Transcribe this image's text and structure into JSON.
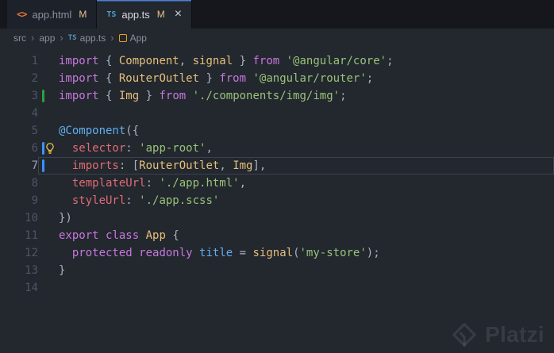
{
  "theme": {
    "kw": "#c678dd",
    "cls": "#e5c07b",
    "fn": "#61afef",
    "prop": "#e06c75",
    "str": "#98c379",
    "pun": "#abb2bf",
    "var": "#61afef",
    "added": "#2ea043",
    "modified": "#3794ff",
    "bulb": "#ffcb43",
    "accent": "#4c7fd6",
    "modified_badge": "#e2c08d",
    "editor_background": "#23272e"
  },
  "tabs": [
    {
      "label": "app.html",
      "icon": "html-file-icon",
      "icon_text": "<>",
      "modified_badge": "M",
      "active": false
    },
    {
      "label": "app.ts",
      "icon": "ts-file-icon",
      "icon_text": "TS",
      "modified_badge": "M",
      "close_label": "×",
      "active": true
    }
  ],
  "breadcrumb": {
    "separator": "›",
    "items": [
      {
        "label": "src"
      },
      {
        "label": "app"
      },
      {
        "label": "app.ts",
        "icon": "ts-file-icon"
      },
      {
        "label": "App",
        "icon": "class-symbol-icon"
      }
    ]
  },
  "editor": {
    "active_line": 7,
    "lightbulb_line": 6,
    "gutter": {
      "added_lines": [
        3
      ],
      "modified_lines": [
        6,
        7
      ]
    },
    "lines": [
      {
        "n": 1,
        "t": [
          [
            "kw",
            "import"
          ],
          [
            "pun",
            " { "
          ],
          [
            "cls",
            "Component"
          ],
          [
            "pun",
            ", "
          ],
          [
            "cls",
            "signal"
          ],
          [
            "pun",
            " } "
          ],
          [
            "kw",
            "from"
          ],
          [
            "pun",
            " "
          ],
          [
            "str",
            "'@angular/core'"
          ],
          [
            "pun",
            ";"
          ]
        ]
      },
      {
        "n": 2,
        "t": [
          [
            "kw",
            "import"
          ],
          [
            "pun",
            " { "
          ],
          [
            "cls",
            "RouterOutlet"
          ],
          [
            "pun",
            " } "
          ],
          [
            "kw",
            "from"
          ],
          [
            "pun",
            " "
          ],
          [
            "str",
            "'@angular/router'"
          ],
          [
            "pun",
            ";"
          ]
        ]
      },
      {
        "n": 3,
        "t": [
          [
            "kw",
            "import"
          ],
          [
            "pun",
            " { "
          ],
          [
            "cls",
            "Img"
          ],
          [
            "pun",
            " } "
          ],
          [
            "kw",
            "from"
          ],
          [
            "pun",
            " "
          ],
          [
            "str",
            "'./components/img/img'"
          ],
          [
            "pun",
            ";"
          ]
        ]
      },
      {
        "n": 4,
        "t": []
      },
      {
        "n": 5,
        "t": [
          [
            "fn",
            "@Component"
          ],
          [
            "pun",
            "({"
          ]
        ]
      },
      {
        "n": 6,
        "t": [
          [
            "pun",
            "  "
          ],
          [
            "prop",
            "selector"
          ],
          [
            "pun",
            ": "
          ],
          [
            "str",
            "'app-root'"
          ],
          [
            "pun",
            ","
          ]
        ]
      },
      {
        "n": 7,
        "t": [
          [
            "pun",
            "  "
          ],
          [
            "prop",
            "imports"
          ],
          [
            "pun",
            ": ["
          ],
          [
            "cls",
            "RouterOutlet"
          ],
          [
            "pun",
            ", "
          ],
          [
            "cls",
            "Img"
          ],
          [
            "pun",
            "],"
          ]
        ]
      },
      {
        "n": 8,
        "t": [
          [
            "pun",
            "  "
          ],
          [
            "prop",
            "templateUrl"
          ],
          [
            "pun",
            ": "
          ],
          [
            "str",
            "'./app.html'"
          ],
          [
            "pun",
            ","
          ]
        ]
      },
      {
        "n": 9,
        "t": [
          [
            "pun",
            "  "
          ],
          [
            "prop",
            "styleUrl"
          ],
          [
            "pun",
            ": "
          ],
          [
            "str",
            "'./app.scss'"
          ]
        ]
      },
      {
        "n": 10,
        "t": [
          [
            "pun",
            "})"
          ]
        ]
      },
      {
        "n": 11,
        "t": [
          [
            "kw",
            "export"
          ],
          [
            "pun",
            " "
          ],
          [
            "kw",
            "class"
          ],
          [
            "pun",
            " "
          ],
          [
            "cls",
            "App"
          ],
          [
            "pun",
            " {"
          ]
        ]
      },
      {
        "n": 12,
        "t": [
          [
            "pun",
            "  "
          ],
          [
            "kw",
            "protected"
          ],
          [
            "pun",
            " "
          ],
          [
            "kw",
            "readonly"
          ],
          [
            "pun",
            " "
          ],
          [
            "var",
            "title"
          ],
          [
            "pun",
            " = "
          ],
          [
            "cls",
            "signal"
          ],
          [
            "pun",
            "("
          ],
          [
            "str",
            "'my-store'"
          ],
          [
            "pun",
            ");"
          ]
        ]
      },
      {
        "n": 13,
        "t": [
          [
            "pun",
            "}"
          ]
        ]
      },
      {
        "n": 14,
        "t": []
      }
    ]
  },
  "watermark": {
    "text": "Platzi"
  }
}
